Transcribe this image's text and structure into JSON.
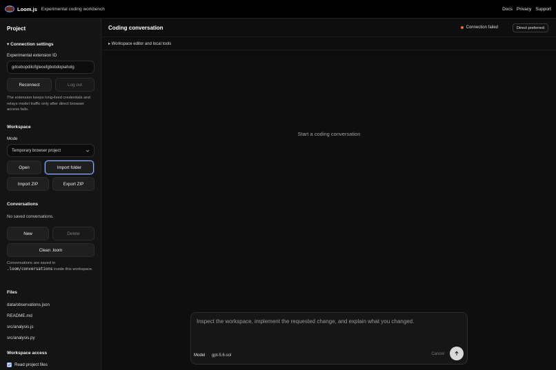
{
  "app": {
    "brand": "Loom.js",
    "tagline": "Experimental coding workbench",
    "nav": [
      "Docs",
      "Privacy",
      "Support"
    ]
  },
  "sidebar": {
    "title": "Project",
    "connection": {
      "heading": "▾ Connection settings",
      "extension_label": "Experimental extension ID",
      "extension_value": "gdcebopdilcifgleoefgbobdopiaholg",
      "reconnect": "Reconnect",
      "logout": "Log out",
      "note": "The extension keeps long-lived credentials and relays model traffic only after direct browser access fails."
    },
    "workspace": {
      "heading": "Workspace",
      "mode_label": "Mode",
      "mode_value": "Temporary browser project",
      "open": "Open",
      "import_folder": "Import folder",
      "import_zip": "Import ZIP",
      "export_zip": "Export ZIP"
    },
    "conversations": {
      "heading": "Conversations",
      "empty": "No saved conversations.",
      "new": "New",
      "delete": "Delete",
      "clean": "Clean .loom",
      "note_prefix": "Conversations are saved in",
      "note_path": ".loom/conversations",
      "note_suffix": "inside this workspace."
    },
    "files": {
      "heading": "Files",
      "items": [
        "data/observations.json",
        "README.md",
        "src/analysis.js",
        "src/analysis.py"
      ]
    },
    "access": {
      "heading": "Workspace access",
      "read_files": "Read project files"
    }
  },
  "main": {
    "title": "Coding conversation",
    "status": "Connection failed",
    "mode_pill": "Direct preferred",
    "tools_toggle": "▸ Workspace editor and local tools",
    "empty": "Start a coding conversation",
    "composer": {
      "placeholder": "Inspect the workspace, implement the requested change, and explain what you changed.",
      "model_label": "Model",
      "model_value": "gpt-5.6-sol",
      "cancel": "Cancel"
    }
  },
  "colors": {
    "status_error": "#e56b4a",
    "focus_ring": "#8fb0ff"
  },
  "icons": {
    "logo": "loom-logo-icon",
    "caret": "chevron-down-icon",
    "send": "arrow-up-icon",
    "checkbox": "checkbox-checked-icon"
  }
}
